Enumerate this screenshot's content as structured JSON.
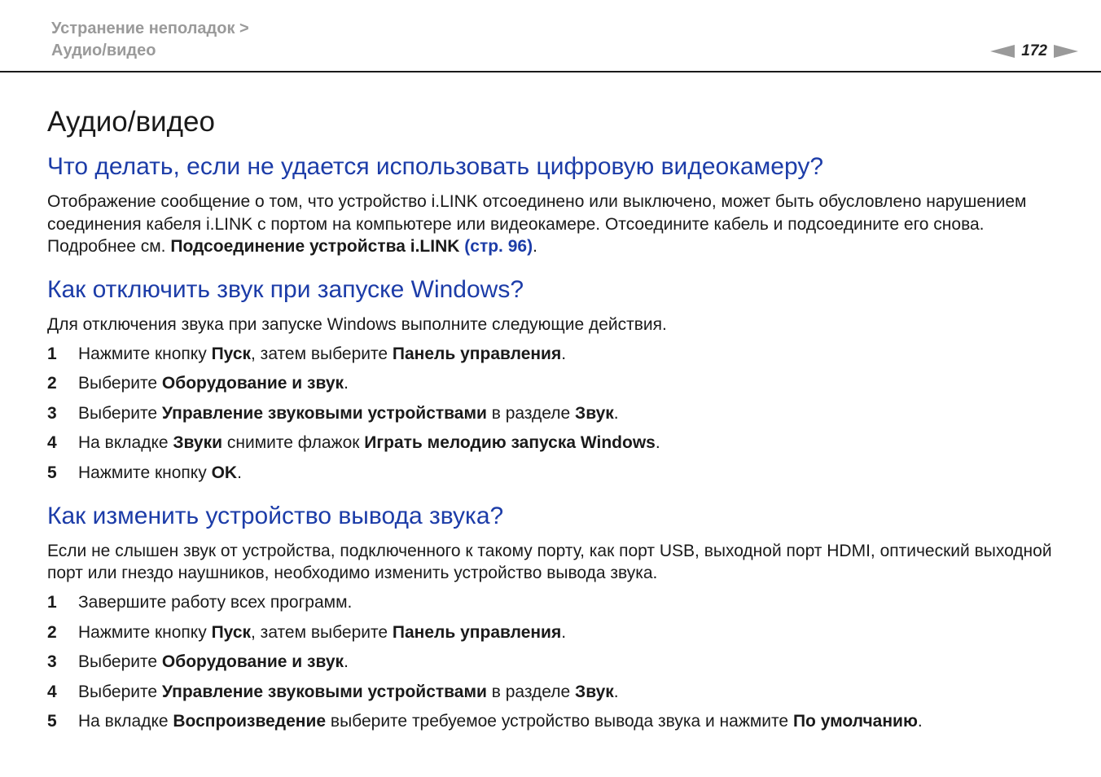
{
  "header": {
    "breadcrumb_line1": "Устранение неполадок >",
    "breadcrumb_line2": "Аудио/видео",
    "page_number": "172"
  },
  "title": "Аудио/видео",
  "sections": [
    {
      "heading": "Что делать, если не удается использовать цифровую видеокамеру?",
      "text_a": "Отображение сообщение о том, что устройство i.LINK отсоединено или выключено, может быть обусловлено нарушением соединения кабеля i.LINK с портом на компьютере или видеокамере. Отсоедините кабель и подсоедините его снова. Подробнее см. ",
      "bold_ref": "Подсоединение устройства i.LINK",
      "link": "(стр. 96)",
      "text_end": "."
    },
    {
      "heading": "Как отключить звук при запуске Windows?",
      "intro": "Для отключения звука при запуске Windows выполните следующие действия.",
      "steps": [
        {
          "n": "1",
          "a": "Нажмите кнопку ",
          "b1": "Пуск",
          "c": ", затем выберите ",
          "b2": "Панель управления",
          "d": "."
        },
        {
          "n": "2",
          "a": "Выберите ",
          "b1": "Оборудование и звук",
          "c": ".",
          "b2": "",
          "d": ""
        },
        {
          "n": "3",
          "a": "Выберите ",
          "b1": "Управление звуковыми устройствами",
          "c": " в разделе ",
          "b2": "Звук",
          "d": "."
        },
        {
          "n": "4",
          "a": "На вкладке ",
          "b1": "Звуки",
          "c": " снимите флажок ",
          "b2": "Играть мелодию запуска Windows",
          "d": "."
        },
        {
          "n": "5",
          "a": "Нажмите кнопку ",
          "b1": "OK",
          "c": ".",
          "b2": "",
          "d": ""
        }
      ]
    },
    {
      "heading": "Как изменить устройство вывода звука?",
      "intro": "Если не слышен звук от устройства, подключенного к такому порту, как порт USB, выходной порт HDMI, оптический выходной порт или гнездо наушников, необходимо изменить устройство вывода звука.",
      "steps": [
        {
          "n": "1",
          "a": "Завершите работу всех программ.",
          "b1": "",
          "c": "",
          "b2": "",
          "d": ""
        },
        {
          "n": "2",
          "a": "Нажмите кнопку ",
          "b1": "Пуск",
          "c": ", затем выберите ",
          "b2": "Панель управления",
          "d": "."
        },
        {
          "n": "3",
          "a": "Выберите ",
          "b1": "Оборудование и звук",
          "c": ".",
          "b2": "",
          "d": ""
        },
        {
          "n": "4",
          "a": "Выберите ",
          "b1": "Управление звуковыми устройствами",
          "c": " в разделе ",
          "b2": "Звук",
          "d": "."
        },
        {
          "n": "5",
          "a": "На вкладке ",
          "b1": "Воспроизведение",
          "c": " выберите требуемое устройство вывода звука и нажмите ",
          "b2": "По умолчанию",
          "d": "."
        }
      ]
    }
  ]
}
